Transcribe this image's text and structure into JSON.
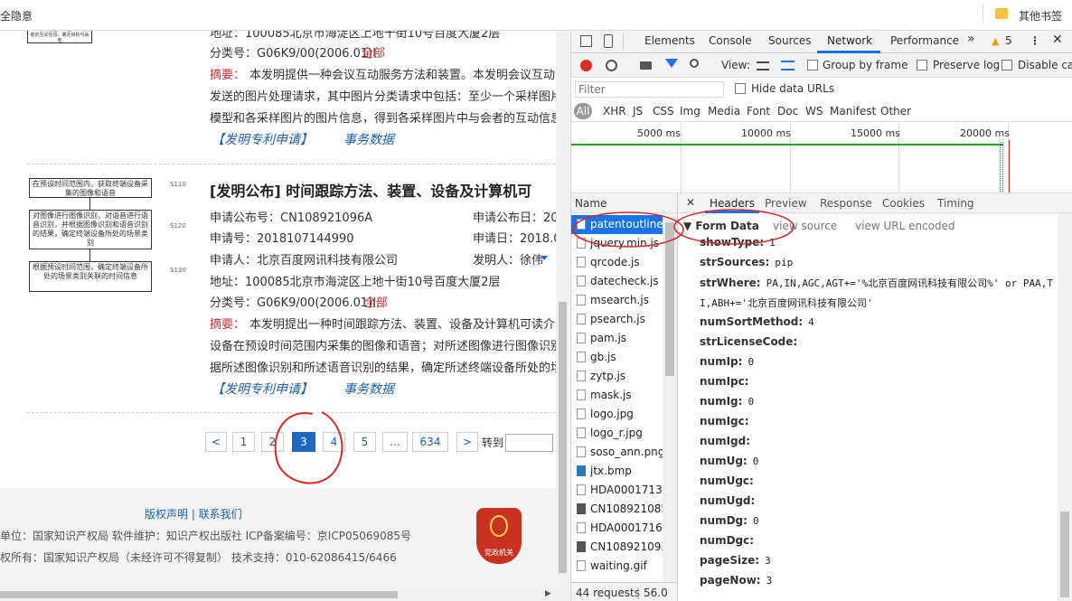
{
  "browser": {
    "tab_left_fragment": "全隐意",
    "bookmark_label": "其他书签"
  },
  "results": {
    "r1": {
      "diagram_line": "S306: 根据各采样图片中与会者的互动信息，确定目标与会者",
      "address": "地址：100085北京市海淀区上地十街10号百度大厦2层",
      "class_no": "分类号：G06K9/00(2006.01)I",
      "class_all": "全部",
      "abstract_label": "摘要：",
      "abstract_lines": [
        "本发明提供一种会议互动服务方法和装置。本发明会议互动",
        "发送的图片处理请求，其中图片分类请求中包括：至少一个采样图片",
        "模型和各采样图片的图片信息，得到各采样图片中与会者的互动信息"
      ],
      "link_patent": "【发明专利申请】",
      "link_affairs": "事务数据"
    },
    "r2": {
      "title": "[发明公布] 时间跟踪方法、装置、设备及计算机可",
      "pub_no": "申请公布号：CN108921096A",
      "pub_date": "申请公布日：201",
      "app_no": "申请号：2018107144990",
      "app_date": "申请日：2018.06",
      "applicant": "申请人：北京百度网讯科技有限公司",
      "inventor": "发明人：徐伟",
      "address": "地址：100085北京市海淀区上地十街10号百度大厦2层",
      "class_no": "分类号：G06K9/00(2006.01)I;",
      "class_all": "全部",
      "abstract_label": "摘要：",
      "abstract_lines": [
        "本发明提出一种时间跟踪方法、装置、设备及计算机可读介",
        "设备在预设时间范围内采集的图像和语音；对所述图像进行图像识别",
        "据所述图像识别和所述语音识别的结果，确定所述终端设备所处的场"
      ],
      "link_patent": "【发明专利申请】",
      "link_affairs": "事务数据",
      "diagram": [
        {
          "text": "在预设时间范围内，获取终端设备采集的图像和语音",
          "tag": "S110"
        },
        {
          "text": "对图像进行图像识别，对语音进行语音识别，并根据图像识别和语音识别的结果，确定终端设备所处的场景类别",
          "tag": "S120"
        },
        {
          "text": "根据预设时间范围，确定终端设备所处的场景类别关联的时间信息",
          "tag": "S130"
        }
      ]
    }
  },
  "pagination": {
    "prev": "<",
    "pages": [
      "1",
      "2",
      "3",
      "4",
      "5",
      "...",
      "634"
    ],
    "current": "3",
    "next": ">",
    "goto_label": "转到"
  },
  "footer": {
    "links": "版权声明 | 联系我们",
    "line1": "单位：国家知识产权局    软件维护：知识产权出版社    ICP备案编号：京ICP05069085号",
    "line2": "权所有：国家知识产权局（未经许可不得复制）    技术支持：010-62086415/6466",
    "badge_text": "党政机关"
  },
  "devtools": {
    "tabs": [
      "Elements",
      "Console",
      "Sources",
      "Network",
      "Performance"
    ],
    "active_tab": "Network",
    "more": "»",
    "warning_count": "5",
    "view_label": "View:",
    "group_by_frame": "Group by frame",
    "preserve_log": "Preserve log",
    "disable_cache": "Disable cac",
    "filter_placeholder": "Filter",
    "hide_data_urls": "Hide data URLs",
    "filter_types": [
      "All",
      "XHR",
      "JS",
      "CSS",
      "Img",
      "Media",
      "Font",
      "Doc",
      "WS",
      "Manifest",
      "Other"
    ],
    "timeline_ticks": [
      "5000 ms",
      "10000 ms",
      "15000 ms",
      "20000 ms"
    ],
    "name_header": "Name",
    "files": [
      {
        "name": "patentoutline.",
        "kind": "doc"
      },
      {
        "name": "jquery.min.js",
        "kind": "doc"
      },
      {
        "name": "qrcode.js",
        "kind": "doc"
      },
      {
        "name": "datecheck.js",
        "kind": "doc"
      },
      {
        "name": "msearch.js",
        "kind": "doc"
      },
      {
        "name": "psearch.js",
        "kind": "doc"
      },
      {
        "name": "pam.js",
        "kind": "doc"
      },
      {
        "name": "gb.js",
        "kind": "doc"
      },
      {
        "name": "zytp.js",
        "kind": "doc"
      },
      {
        "name": "mask.js",
        "kind": "doc"
      },
      {
        "name": "logo.jpg",
        "kind": "doc"
      },
      {
        "name": "logo_r.jpg",
        "kind": "doc"
      },
      {
        "name": "soso_ann.png",
        "kind": "doc"
      },
      {
        "name": "jtx.bmp",
        "kind": "bmp"
      },
      {
        "name": "HDA00017134",
        "kind": "doc"
      },
      {
        "name": "CN108921085.",
        "kind": "img"
      },
      {
        "name": "HDA00017161",
        "kind": "doc"
      },
      {
        "name": "CN108921093.",
        "kind": "img"
      },
      {
        "name": "waiting.gif",
        "kind": "doc"
      }
    ],
    "status_requests": "44 requests",
    "status_size": "56.0",
    "detail_tabs": [
      "Headers",
      "Preview",
      "Response",
      "Cookies",
      "Timing"
    ],
    "detail_active": "Headers",
    "form_data_title": "▼ Form Data",
    "view_source": "view source",
    "view_url_encoded": "view URL encoded",
    "form_fields": [
      {
        "key": "showType:",
        "value": "1"
      },
      {
        "key": "strSources:",
        "value": "pip"
      },
      {
        "key": "strWhere:",
        "value": "PA,IN,AGC,AGT+='%北京百度网讯科技有限公司%' or PAA,T"
      },
      {
        "key": "",
        "value": "I,ABH+='北京百度网讯科技有限公司'"
      },
      {
        "key": "numSortMethod:",
        "value": "4"
      },
      {
        "key": "strLicenseCode:",
        "value": ""
      },
      {
        "key": "numIp:",
        "value": "0"
      },
      {
        "key": "numIpc:",
        "value": ""
      },
      {
        "key": "numIg:",
        "value": "0"
      },
      {
        "key": "numIgc:",
        "value": ""
      },
      {
        "key": "numIgd:",
        "value": ""
      },
      {
        "key": "numUg:",
        "value": "0"
      },
      {
        "key": "numUgc:",
        "value": ""
      },
      {
        "key": "numUgd:",
        "value": ""
      },
      {
        "key": "numDg:",
        "value": "0"
      },
      {
        "key": "numDgc:",
        "value": ""
      },
      {
        "key": "pageSize:",
        "value": "3"
      },
      {
        "key": "pageNow:",
        "value": "3"
      }
    ]
  }
}
